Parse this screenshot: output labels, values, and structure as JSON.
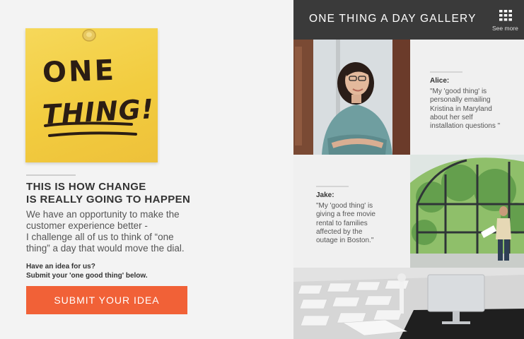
{
  "left": {
    "sticky_note": {
      "line1": "ONE",
      "line2": "THING!"
    },
    "headline": [
      "THIS IS HOW CHANGE",
      "IS REALLY GOING TO HAPPEN"
    ],
    "body": [
      "We have an opportunity to make the",
      "customer experience better -",
      "I challenge all of us to think of “one",
      "thing” a day that would move the dial."
    ],
    "cta": [
      "Have an idea for us?",
      "Submit your 'one good thing' below."
    ],
    "submit_label": "SUBMIT YOUR IDEA"
  },
  "gallery": {
    "title": "ONE THING A DAY GALLERY",
    "see_more": "See more",
    "entries": [
      {
        "name": "Alice:",
        "quote": [
          "\"My 'good thing' is",
          "personally emailing",
          "Kristina in Maryland",
          "about her self",
          "installation questions \""
        ]
      },
      {
        "name": "Jake:",
        "quote": [
          "\"My 'good thing' is",
          "giving a free movie",
          "rental to families",
          "affected by the",
          "outage in Boston.\""
        ]
      }
    ]
  },
  "colors": {
    "accent": "#f16137",
    "header": "#3a3a3a",
    "sticky": "#f2cc3f"
  },
  "icons": {
    "see_more": "grid-icon",
    "pin": "pushpin-icon"
  }
}
